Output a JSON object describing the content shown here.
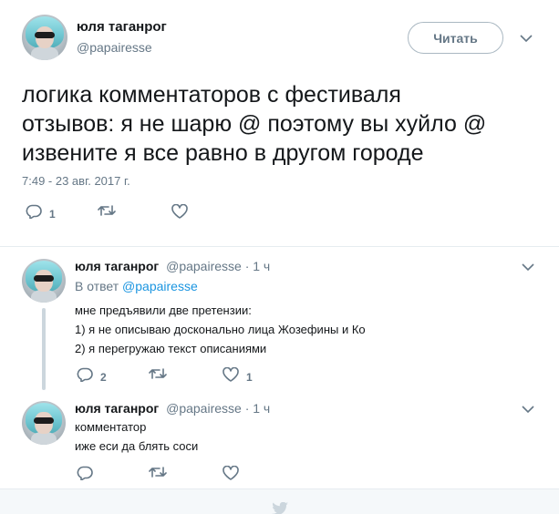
{
  "main_tweet": {
    "name": "юля таганрог",
    "handle": "@papairesse",
    "follow_label": "Читать",
    "text_lines": [
      "логика комментаторов с фестиваля",
      "отзывов: я не шарю @ поэтому вы хуйло @",
      "извените я все равно в другом городе"
    ],
    "timestamp": "7:49 - 23 авг. 2017 г.",
    "reply_count": "1",
    "retweet_count": "",
    "like_count": ""
  },
  "replies": [
    {
      "name": "юля таганрог",
      "handle": "@papairesse · 1 ч",
      "in_reply_prefix": "В ответ ",
      "in_reply_handle": "@papairesse",
      "lines": [
        "мне предъявили две претензии:",
        "1) я не описываю досконально лица Жозефины и Ко",
        "2) я перегружаю текст описаниями"
      ],
      "reply_count": "2",
      "retweet_count": "",
      "like_count": "1"
    },
    {
      "name": "юля таганрог",
      "handle": "@papairesse · 1 ч",
      "lines": [
        "комментатор",
        "иже еси да блять соси"
      ],
      "reply_count": "",
      "retweet_count": "",
      "like_count": ""
    }
  ],
  "colors": {
    "text": "#14171a",
    "secondary": "#657786",
    "link": "#1b95e0",
    "divider": "#e6ecf0",
    "thread_line": "#ccd6dd"
  },
  "icons": [
    "reply-icon",
    "retweet-icon",
    "like-icon",
    "chevron-down-icon",
    "twitter-bird-icon"
  ]
}
